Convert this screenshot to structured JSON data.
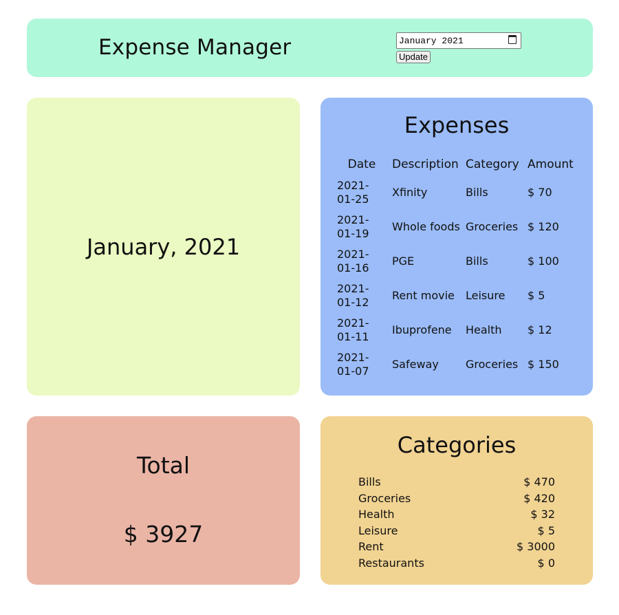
{
  "header": {
    "title": "Expense Manager",
    "month_value": "January 2021",
    "month_input_value": "2021-01",
    "update_label": "Update"
  },
  "month_card": {
    "label": "January, 2021"
  },
  "expenses": {
    "title": "Expenses",
    "columns": [
      "Date",
      "Description",
      "Category",
      "Amount"
    ],
    "rows": [
      {
        "date": "2021-01-25",
        "description": "Xfinity",
        "category": "Bills",
        "amount": "$ 70"
      },
      {
        "date": "2021-01-19",
        "description": "Whole foods",
        "category": "Groceries",
        "amount": "$ 120"
      },
      {
        "date": "2021-01-16",
        "description": "PGE",
        "category": "Bills",
        "amount": "$ 100"
      },
      {
        "date": "2021-01-12",
        "description": "Rent movie",
        "category": "Leisure",
        "amount": "$ 5"
      },
      {
        "date": "2021-01-11",
        "description": "Ibuprofene",
        "category": "Health",
        "amount": "$ 12"
      },
      {
        "date": "2021-01-07",
        "description": "Safeway",
        "category": "Groceries",
        "amount": "$ 150"
      }
    ]
  },
  "total": {
    "title": "Total",
    "value": "$ 3927"
  },
  "categories": {
    "title": "Categories",
    "items": [
      {
        "name": "Bills",
        "amount": "$ 470"
      },
      {
        "name": "Groceries",
        "amount": "$ 420"
      },
      {
        "name": "Health",
        "amount": "$ 32"
      },
      {
        "name": "Leisure",
        "amount": "$ 5"
      },
      {
        "name": "Rent",
        "amount": "$ 3000"
      },
      {
        "name": "Restaurants",
        "amount": "$ 0"
      }
    ]
  },
  "colors": {
    "header_bg": "#b0f8da",
    "month_bg": "#ebf9c2",
    "expenses_bg": "#9bbcf8",
    "total_bg": "#ebb5a6",
    "categories_bg": "#f1d392"
  },
  "icons": {
    "date_picker": "calendar-icon"
  }
}
